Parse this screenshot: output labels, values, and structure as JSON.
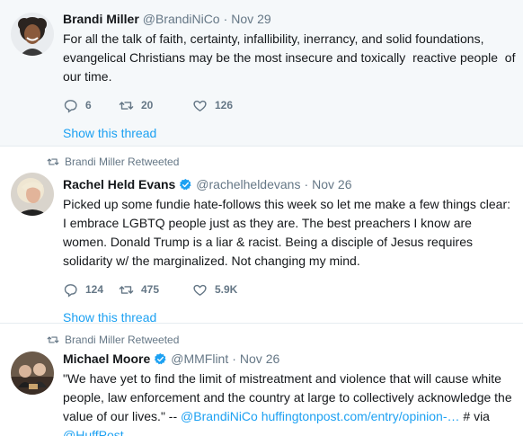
{
  "tweets": [
    {
      "retweeted_by": "",
      "name": "Brandi Miller",
      "verified": false,
      "handle": "@BrandiNiCo",
      "separator": "·",
      "time": "Nov 29",
      "text": "For all the talk of faith, certainty, infallibility, inerrancy, and solid foundations, evangelical Christians may be the most insecure and toxically  reactive people  of our time.",
      "replies": "6",
      "retweets": "20",
      "likes": "126",
      "show_thread": "Show this thread"
    },
    {
      "retweeted_by": "Brandi Miller Retweeted",
      "name": "Rachel Held Evans",
      "verified": true,
      "handle": "@rachelheldevans",
      "separator": "·",
      "time": "Nov 26",
      "text": "Picked up some fundie hate-follows this week so let me make a few things clear: I embrace LGBTQ people just as they are. The best preachers I know are women. Donald Trump is a liar & racist. Being a disciple of Jesus requires solidarity w/ the marginalized. Not changing my mind.",
      "replies": "124",
      "retweets": "475",
      "likes": "5.9K",
      "show_thread": "Show this thread"
    },
    {
      "retweeted_by": "Brandi Miller Retweeted",
      "name": "Michael Moore",
      "verified": true,
      "handle": "@MMFlint",
      "separator": "·",
      "time": "Nov 26",
      "text_plain": "\"We have yet to find the limit of mistreatment and violence that will cause white people, law enforcement and the country at large to collectively acknowledge the value of our lives.\" -- ",
      "mention_1": "@BrandiNiCo",
      "link_1": "huffingtonpost.com/entry/opinion-…",
      "text_tail": " # via ",
      "mention_2": "@HuffPost"
    }
  ],
  "colors": {
    "accent": "#1da1f2",
    "secondary_text": "#657786",
    "primary_text": "#14171a",
    "highlight_background": "#f5f8fa",
    "divider": "#e6ecf0"
  },
  "icons": {
    "reply": "reply-icon",
    "retweet": "retweet-icon",
    "like": "heart-icon",
    "verified": "verified-badge-icon",
    "retweeted_context": "retweet-small-icon"
  }
}
